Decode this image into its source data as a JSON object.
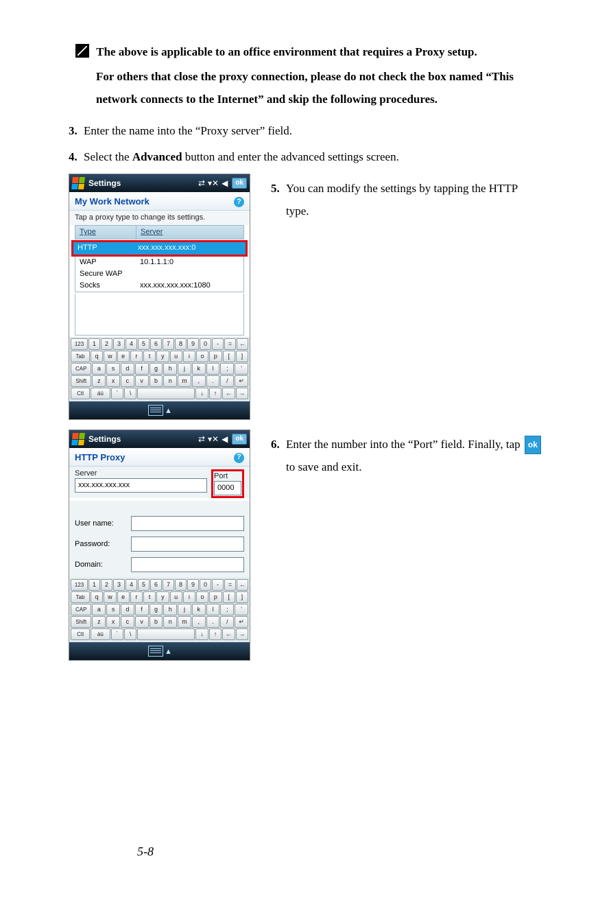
{
  "note": {
    "line1": "The above is applicable to an office environment that requires a Proxy setup.",
    "line2": "For others that close the proxy connection, please do not check the box named “This network connects to the Internet” and skip the following procedures."
  },
  "steps": {
    "s3": {
      "num": "3.",
      "text": "Enter the name into the “Proxy server” field."
    },
    "s4": {
      "num": "4.",
      "pre": "Select the ",
      "bold": "Advanced",
      "post": " button and enter the advanced settings screen."
    },
    "s5": {
      "num": "5.",
      "text": "You can modify the settings by tapping the HTTP type."
    },
    "s6": {
      "num": "6.",
      "pre": "Enter the number into the “Port” field. Finally, tap ",
      "ok": "ok",
      "post": " to save and exit."
    }
  },
  "device1": {
    "title": "Settings",
    "ok": "ok",
    "subtitle": "My Work Network",
    "instr": "Tap a proxy type to change its settings.",
    "headers": {
      "c1": "Type",
      "c2": "Server"
    },
    "rows": {
      "http": {
        "type": "HTTP",
        "server": "xxx.xxx.xxx.xxx:0"
      },
      "wap": {
        "type": "WAP",
        "server": "10.1.1.1:0"
      },
      "swap": {
        "type": "Secure WAP",
        "server": ""
      },
      "socks": {
        "type": "Socks",
        "server": "xxx.xxx.xxx.xxx:1080"
      }
    }
  },
  "device2": {
    "title": "Settings",
    "ok": "ok",
    "subtitle": "HTTP Proxy",
    "labels": {
      "server": "Server",
      "port": "Port",
      "user": "User name:",
      "pass": "Password:",
      "domain": "Domain:"
    },
    "values": {
      "server": "xxx.xxx.xxx.xxx",
      "port": "0000"
    }
  },
  "keyboard": {
    "r1": [
      "123",
      "1",
      "2",
      "3",
      "4",
      "5",
      "6",
      "7",
      "8",
      "9",
      "0",
      "-",
      "=",
      "←"
    ],
    "r2": [
      "Tab",
      "q",
      "w",
      "e",
      "r",
      "t",
      "y",
      "u",
      "i",
      "o",
      "p",
      "[",
      "]"
    ],
    "r3": [
      "CAP",
      "a",
      "s",
      "d",
      "f",
      "g",
      "h",
      "j",
      "k",
      "l",
      ";",
      "'"
    ],
    "r4": [
      "Shift",
      "z",
      "x",
      "c",
      "v",
      "b",
      "n",
      "m",
      ",",
      ".",
      "/",
      "↵"
    ],
    "r5": [
      "Ctl",
      "áü",
      "`",
      "\\",
      "",
      "↓",
      "↑",
      "←",
      "→"
    ]
  },
  "page_number": "5-8"
}
